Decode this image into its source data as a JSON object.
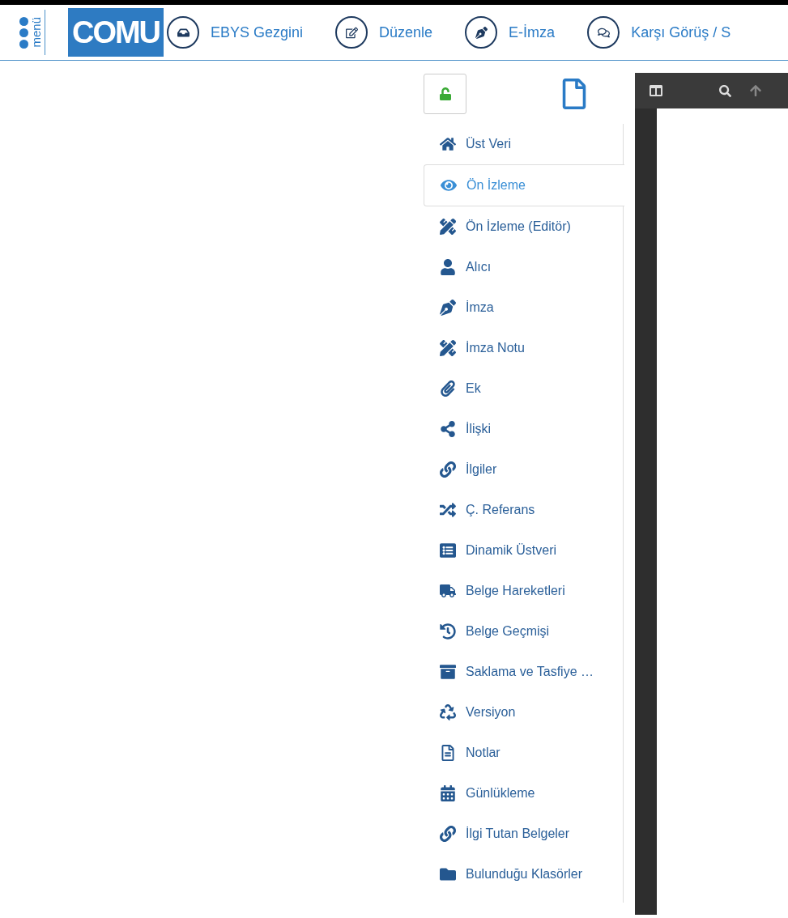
{
  "header": {
    "menu_label": "menü",
    "logo": "COMU",
    "nav": [
      {
        "label": "EBYS Gezgini"
      },
      {
        "label": "Düzenle"
      },
      {
        "label": "E-İmza"
      },
      {
        "label": "Karşı Görüş / S"
      }
    ]
  },
  "toolbar": {
    "locked": false
  },
  "sidebar": {
    "items": [
      {
        "label": "Üst Veri",
        "selected": false
      },
      {
        "label": "Ön İzleme",
        "selected": true
      },
      {
        "label": "Ön İzleme (Editör)",
        "selected": false
      },
      {
        "label": "Alıcı",
        "selected": false
      },
      {
        "label": "İmza",
        "selected": false
      },
      {
        "label": "İmza Notu",
        "selected": false
      },
      {
        "label": "Ek",
        "selected": false
      },
      {
        "label": "İlişki",
        "selected": false
      },
      {
        "label": "İlgiler",
        "selected": false
      },
      {
        "label": "Ç. Referans",
        "selected": false
      },
      {
        "label": "Dinamik Üstveri",
        "selected": false
      },
      {
        "label": "Belge Hareketleri",
        "selected": false
      },
      {
        "label": "Belge Geçmişi",
        "selected": false
      },
      {
        "label": "Saklama ve Tasfiye …",
        "selected": false
      },
      {
        "label": "Versiyon",
        "selected": false
      },
      {
        "label": "Notlar",
        "selected": false
      },
      {
        "label": "Günlükleme",
        "selected": false
      },
      {
        "label": "İlgi Tutan Belgeler",
        "selected": false
      },
      {
        "label": "Bulunduğu Klasörler",
        "selected": false
      }
    ]
  }
}
